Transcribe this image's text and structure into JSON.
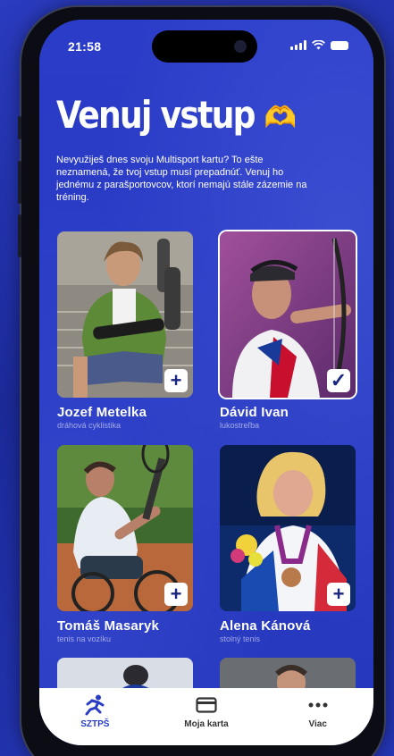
{
  "status_bar": {
    "time": "21:58"
  },
  "header": {
    "title": "Venuj vstup",
    "title_emoji": "🫶",
    "subtitle": "Nevyužiješ dnes svoju Multisport kartu? To ešte neznamená, že tvoj vstup musí prepadnúť. Venuj ho jednému z parašportovcov, ktorí nemajú stále zázemie na tréning."
  },
  "athletes": [
    {
      "name": "Jozef Metelka",
      "sport": "dráhová cyklistika",
      "selected": false,
      "action_icon": "plus-icon",
      "action_symbol": "+"
    },
    {
      "name": "Dávid Ivan",
      "sport": "lukostreľba",
      "selected": true,
      "action_icon": "check-icon",
      "action_symbol": "✓"
    },
    {
      "name": "Tomáš Masaryk",
      "sport": "tenis na vozíku",
      "selected": false,
      "action_icon": "plus-icon",
      "action_symbol": "+"
    },
    {
      "name": "Alena Kánová",
      "sport": "stolný tenis",
      "selected": false,
      "action_icon": "plus-icon",
      "action_symbol": "+"
    }
  ],
  "tab_bar": {
    "items": [
      {
        "label": "SZTPŠ",
        "icon": "runner-icon",
        "active": true
      },
      {
        "label": "Moja karta",
        "icon": "card-icon",
        "active": false
      },
      {
        "label": "Viac",
        "icon": "more-icon",
        "active": false
      }
    ]
  },
  "colors": {
    "brand": "#2a3cc4",
    "text_on_brand": "#ffffff"
  }
}
